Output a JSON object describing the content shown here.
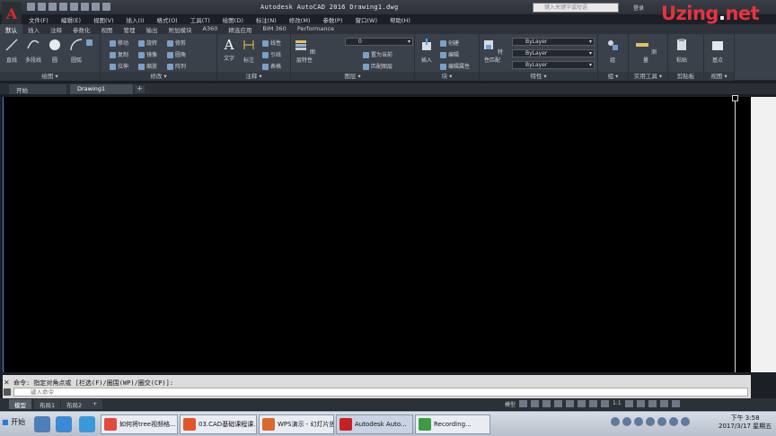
{
  "window": {
    "title": "Autodesk AutoCAD 2016    Drawing1.dwg",
    "search_placeholder": "键入关键字或短语",
    "login": "登录",
    "brand_left": "Uzing",
    "brand_dot": ".",
    "brand_right": "net"
  },
  "menu": [
    "文件(F)",
    "编辑(E)",
    "视图(V)",
    "插入(I)",
    "格式(O)",
    "工具(T)",
    "绘图(D)",
    "标注(N)",
    "修改(M)",
    "参数(P)",
    "窗口(W)",
    "帮助(H)"
  ],
  "ribbon_tabs": [
    "默认",
    "插入",
    "注释",
    "参数化",
    "视图",
    "管理",
    "输出",
    "附加模块",
    "A360",
    "精选应用",
    "BIM 360",
    "Performance"
  ],
  "panels": {
    "draw": {
      "label": "绘图 ▾",
      "tools": [
        "直线",
        "多段线",
        "圆",
        "圆弧"
      ]
    },
    "modify": {
      "label": "修改 ▾",
      "tools": [
        "移动",
        "旋转",
        "修剪",
        "复制",
        "镜像",
        "圆角",
        "拉伸",
        "缩放",
        "阵列"
      ]
    },
    "annotation": {
      "label": "注释 ▾",
      "tools": [
        "文字",
        "标注",
        "线性",
        "引线",
        "表格"
      ]
    },
    "layers": {
      "label": "图层 ▾",
      "tools": [
        "图层特性",
        "置为当前",
        "匹配图层"
      ],
      "layer_value": "0"
    },
    "block": {
      "label": "块 ▾",
      "tools": [
        "插入",
        "创建",
        "编辑",
        "编辑属性"
      ]
    },
    "properties": {
      "label": "特性 ▾",
      "tools": [
        "特性匹配"
      ],
      "combos": [
        "ByLayer",
        "ByLayer",
        "ByLayer"
      ]
    },
    "groups": {
      "label": "组 ▾",
      "tools": [
        "组"
      ]
    },
    "utilities": {
      "label": "实用工具 ▾",
      "tools": [
        "测量"
      ]
    },
    "clipboard": {
      "label": "剪贴板",
      "tools": [
        "粘贴"
      ]
    },
    "view": {
      "label": "视图 ▾",
      "tools": [
        "基点"
      ]
    }
  },
  "doc_tabs": [
    "开始",
    "Drawing1"
  ],
  "command": {
    "history": "命令: 指定对角点或 [栏选(F)/圈围(WP)/圈交(CP)]:",
    "placeholder": "键入命令"
  },
  "layout_tabs": [
    "模型",
    "布局1",
    "布局2"
  ],
  "status": {
    "model": "模型",
    "scale": "1:1"
  },
  "taskbar": {
    "start": "开始",
    "tasks": [
      "如何将tree视频格...",
      "03.CAD基础课程课...",
      "WPS演示 - 幻灯片放...",
      "Autodesk Auto...",
      "Recording..."
    ],
    "time": "下午 3:58",
    "date": "2017/3/17 星期五"
  }
}
